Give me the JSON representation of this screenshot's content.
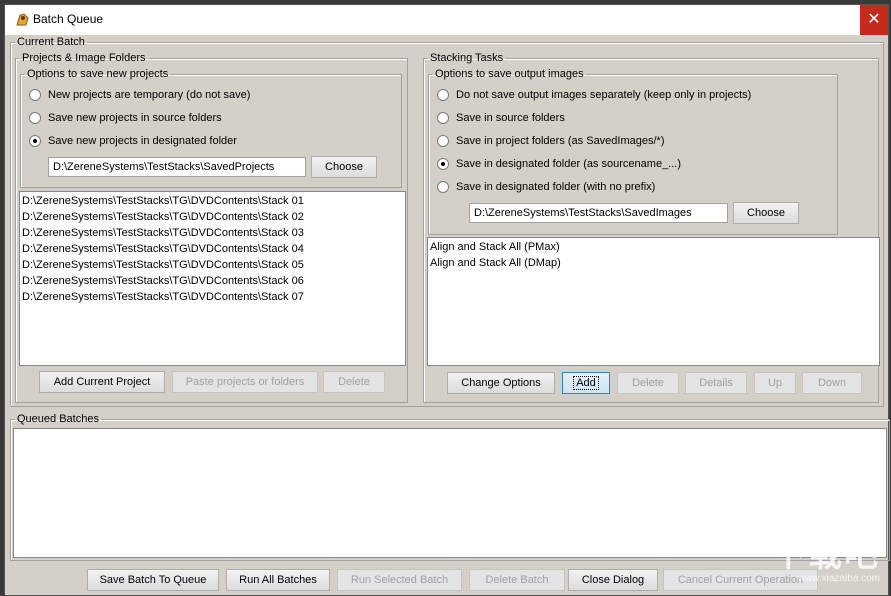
{
  "window": {
    "title": "Batch Queue",
    "close_glyph": "✕"
  },
  "current_batch": {
    "legend": "Current Batch",
    "projects": {
      "legend": "Projects & Image Folders",
      "options_legend": "Options to save new projects",
      "radios": [
        {
          "label": "New projects are temporary (do not save)",
          "selected": false
        },
        {
          "label": "Save new projects in source folders",
          "selected": false
        },
        {
          "label": "Save new projects in designated folder",
          "selected": true
        }
      ],
      "folder_path": "D:\\ZereneSystems\\TestStacks\\SavedProjects",
      "choose_label": "Choose",
      "folders": [
        "D:\\ZereneSystems\\TestStacks\\TG\\DVDContents\\Stack 01",
        "D:\\ZereneSystems\\TestStacks\\TG\\DVDContents\\Stack 02",
        "D:\\ZereneSystems\\TestStacks\\TG\\DVDContents\\Stack 03",
        "D:\\ZereneSystems\\TestStacks\\TG\\DVDContents\\Stack 04",
        "D:\\ZereneSystems\\TestStacks\\TG\\DVDContents\\Stack 05",
        "D:\\ZereneSystems\\TestStacks\\TG\\DVDContents\\Stack 06",
        "D:\\ZereneSystems\\TestStacks\\TG\\DVDContents\\Stack 07"
      ],
      "add_current_label": "Add Current Project",
      "paste_label": "Paste projects or folders",
      "delete_label": "Delete"
    },
    "stacking": {
      "legend": "Stacking Tasks",
      "options_legend": "Options to save output images",
      "radios": [
        {
          "label": "Do not save output images separately (keep only in projects)",
          "selected": false
        },
        {
          "label": "Save in source folders",
          "selected": false
        },
        {
          "label": "Save in project folders (as SavedImages/*)",
          "selected": false
        },
        {
          "label": "Save in designated folder (as sourcename_...)",
          "selected": true
        },
        {
          "label": "Save in designated folder (with no prefix)",
          "selected": false
        }
      ],
      "folder_path": "D:\\ZereneSystems\\TestStacks\\SavedImages",
      "choose_label": "Choose",
      "tasks": [
        "Align and Stack All (PMax)",
        "Align and Stack All (DMap)"
      ],
      "change_options_label": "Change Options",
      "add_label": "Add",
      "delete_label": "Delete",
      "details_label": "Details",
      "up_label": "Up",
      "down_label": "Down"
    }
  },
  "queued": {
    "legend": "Queued Batches"
  },
  "bottom": {
    "save_batch_label": "Save Batch To Queue",
    "run_all_label": "Run All Batches",
    "run_selected_label": "Run Selected Batch",
    "delete_batch_label": "Delete Batch",
    "close_label": "Close Dialog",
    "cancel_label": "Cancel Current Operation"
  },
  "watermark": {
    "big": "下载吧",
    "small": "www.xiazaiba.com"
  }
}
